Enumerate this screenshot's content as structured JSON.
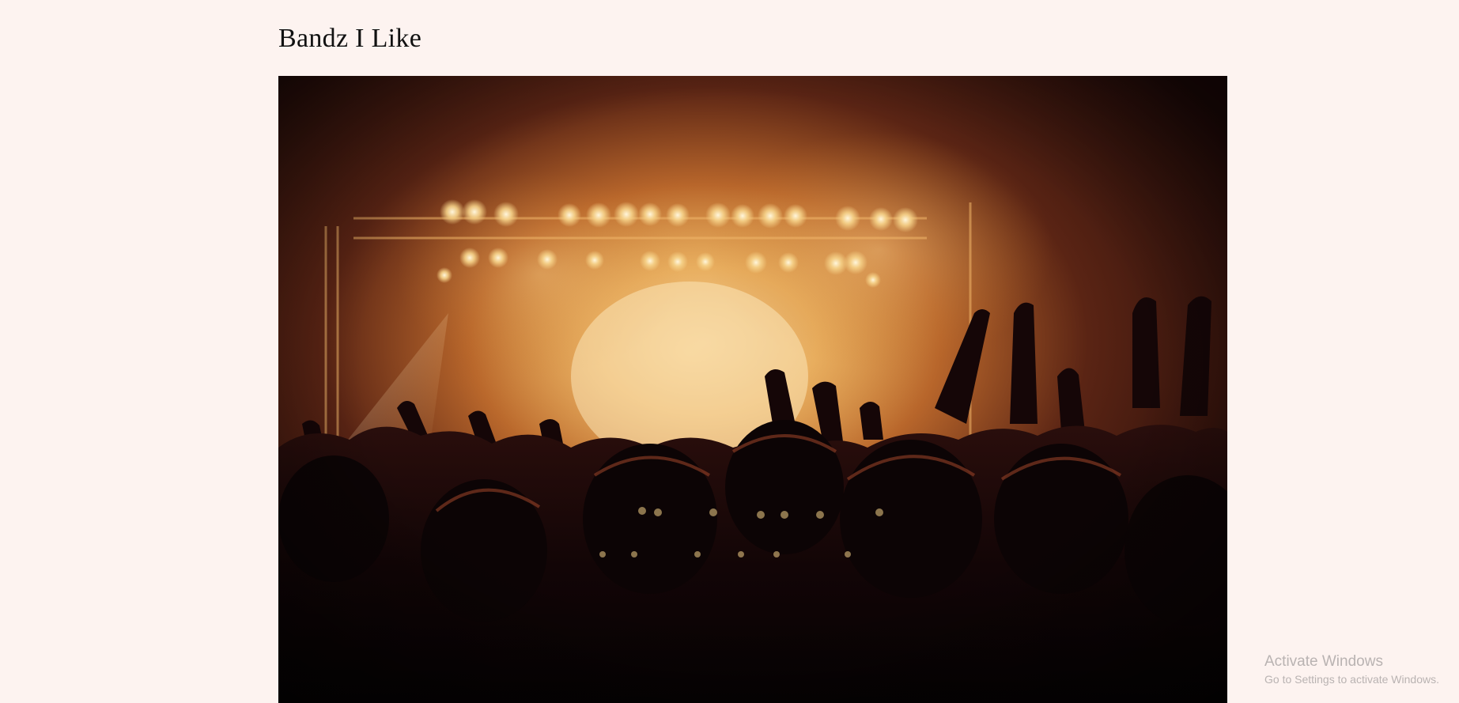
{
  "page": {
    "title": "Bandz I Like",
    "background": "#fdf3f0"
  },
  "hero": {
    "alt": "Concert crowd with raised hands in front of a smoky, stage-lit venue",
    "palette": {
      "glow": "#f7d79a",
      "smoke": "#c8782c",
      "dark": "#1a0806",
      "crowd": "#0b0405"
    }
  },
  "watermark": {
    "title": "Activate Windows",
    "subtitle": "Go to Settings to activate Windows."
  }
}
